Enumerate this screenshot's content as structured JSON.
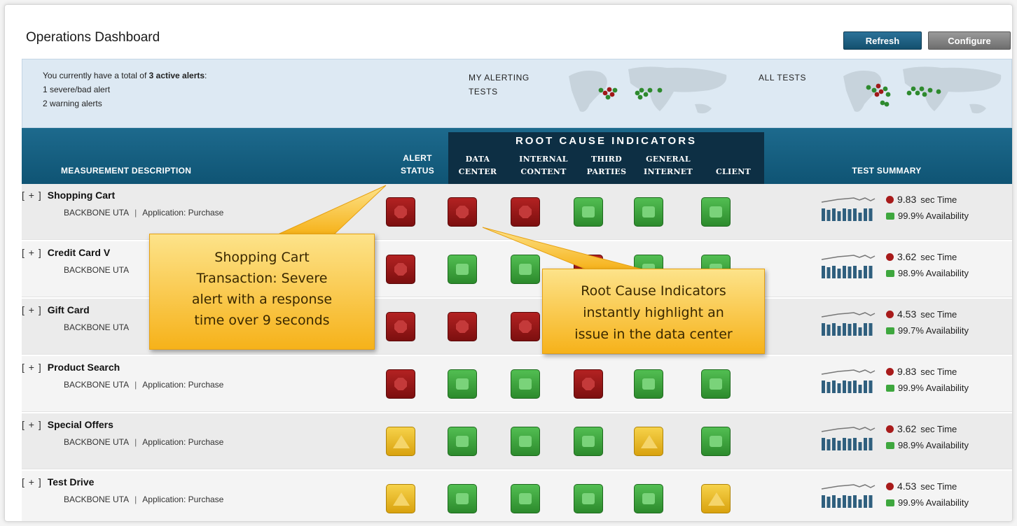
{
  "header": {
    "title": "Operations Dashboard",
    "refresh_label": "Refresh",
    "configure_label": "Configure"
  },
  "alert_summary": {
    "line1_prefix": "You currently have a total of ",
    "line1_bold": "3 active alerts",
    "line1_suffix": ":",
    "line2": "1 severe/bad alert",
    "line3": "2 warning alerts",
    "my_alerting_label_1": "MY ALERTING",
    "my_alerting_label_2": "TESTS",
    "all_tests_label": "ALL TESTS"
  },
  "columns": {
    "measurement": "MEASUREMENT DESCRIPTION",
    "alert_status_1": "ALERT",
    "alert_status_2": "STATUS",
    "rci_title": "ROOT CAUSE INDICATORS",
    "data_center_1": "DATA",
    "data_center_2": "CENTER",
    "internal_content_1": "INTERNAL",
    "internal_content_2": "CONTENT",
    "third_parties_1": "THIRD",
    "third_parties_2": "PARTIES",
    "general_internet_1": "GENERAL",
    "general_internet_2": "INTERNET",
    "client": "CLIENT",
    "test_summary": "TEST SUMMARY"
  },
  "rows": [
    {
      "expander": "[ + ]",
      "name": "Shopping Cart",
      "backbone": "BACKBONE UTA",
      "separator": "|",
      "application": "Application: Purchase",
      "statuses": [
        "red",
        "red",
        "red",
        "green",
        "green",
        "green"
      ],
      "time_value": "9.83",
      "time_label": "sec Time",
      "availability_value": "99.9",
      "availability_label": "% Availability"
    },
    {
      "expander": "[ + ]",
      "name": "Credit Card V",
      "backbone": "BACKBONE UTA",
      "separator": "",
      "application": "",
      "statuses": [
        "red",
        "green",
        "green",
        "red",
        "green",
        "green"
      ],
      "time_value": "3.62",
      "time_label": "sec Time",
      "availability_value": "98.9",
      "availability_label": "% Availability"
    },
    {
      "expander": "[ + ]",
      "name": "Gift Card",
      "backbone": "BACKBONE UTA",
      "separator": "",
      "application": "",
      "statuses": [
        "red",
        "red",
        "red",
        "green",
        "green",
        "green"
      ],
      "time_value": "4.53",
      "time_label": "sec Time",
      "availability_value": "99.7",
      "availability_label": "% Availability"
    },
    {
      "expander": "[ + ]",
      "name": "Product Search",
      "backbone": "BACKBONE UTA",
      "separator": "|",
      "application": "Application: Purchase",
      "statuses": [
        "red",
        "green",
        "green",
        "red",
        "green",
        "green"
      ],
      "time_value": "9.83",
      "time_label": "sec Time",
      "availability_value": "99.9",
      "availability_label": "% Availability"
    },
    {
      "expander": "[ + ]",
      "name": "Special Offers",
      "backbone": "BACKBONE UTA",
      "separator": "|",
      "application": "Application: Purchase",
      "statuses": [
        "yellow",
        "green",
        "green",
        "green",
        "yellow",
        "green"
      ],
      "time_value": "3.62",
      "time_label": "sec Time",
      "availability_value": "98.9",
      "availability_label": "% Availability"
    },
    {
      "expander": "[ + ]",
      "name": "Test Drive",
      "backbone": "BACKBONE UTA",
      "separator": "|",
      "application": "Application: Purchase",
      "statuses": [
        "yellow",
        "green",
        "green",
        "green",
        "green",
        "yellow"
      ],
      "time_value": "4.53",
      "time_label": "sec Time",
      "availability_value": "99.9",
      "availability_label": "% Availability"
    }
  ],
  "callouts": {
    "shopping_cart": [
      "Shopping Cart",
      "Transaction: Severe",
      "alert with a response",
      "time over 9 seconds"
    ],
    "root_cause": [
      "Root Cause Indicators",
      "instantly highlight an",
      "issue in the data center"
    ]
  },
  "colors": {
    "header_band": "#0f5474",
    "rci_box": "#0d2f44",
    "severe": "#a81b1b",
    "ok": "#3ea73e",
    "warning": "#e8b820",
    "callout": "#f6b21a"
  }
}
